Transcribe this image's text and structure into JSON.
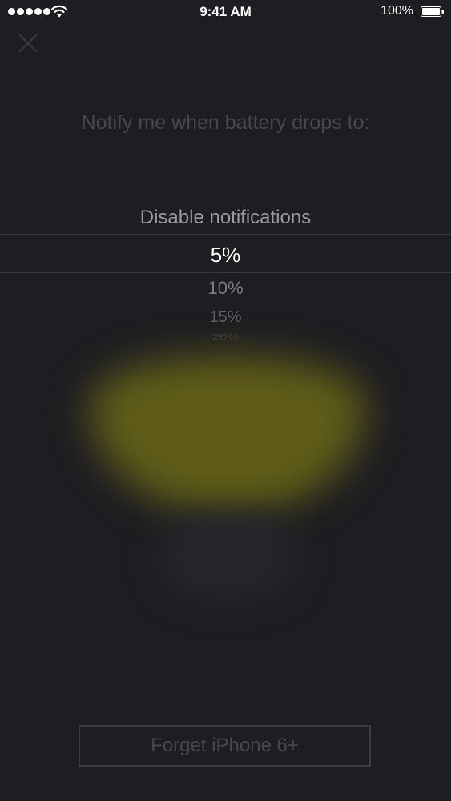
{
  "status_bar": {
    "time": "9:41 AM",
    "battery_percent": "100%",
    "signal_icon": "signal-dots-icon",
    "wifi_icon": "wifi-icon",
    "battery_icon": "battery-icon"
  },
  "close_icon": "close-icon",
  "prompt": "Notify me when battery drops to:",
  "picker": {
    "options": [
      "Disable notifications",
      "5%",
      "10%",
      "15%",
      "20%"
    ],
    "selected": "5%"
  },
  "forget_button": "Forget iPhone 6+",
  "colors": {
    "background": "#1e1d21",
    "glow": "#5f5d18",
    "muted_text": "#48474d"
  }
}
